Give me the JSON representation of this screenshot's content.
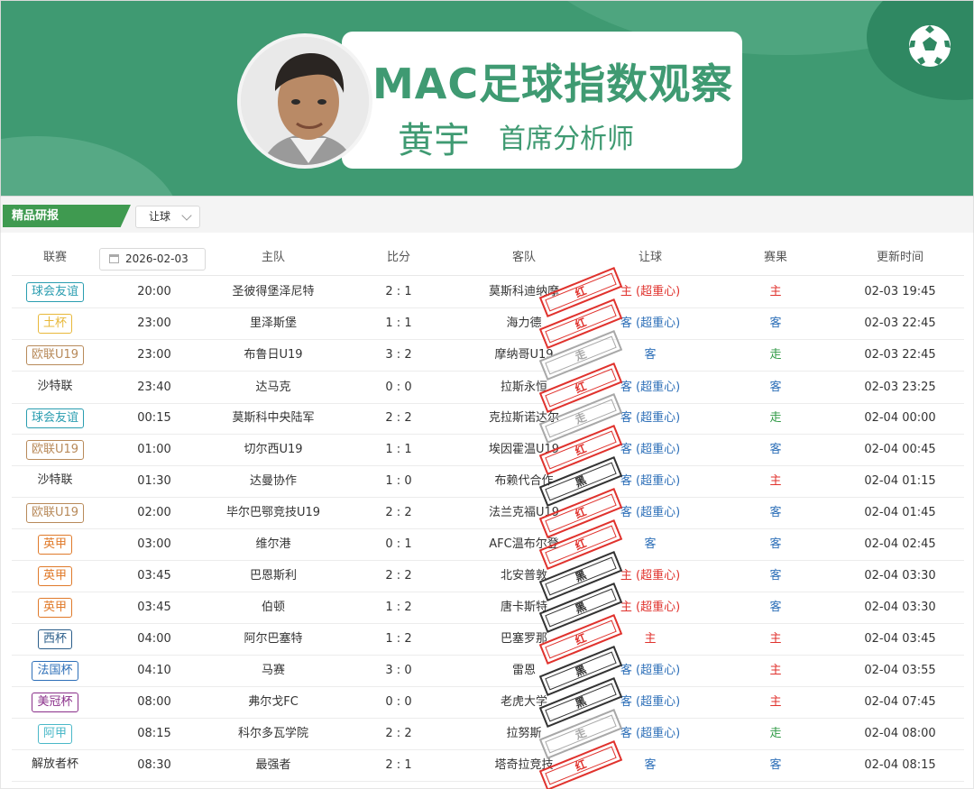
{
  "banner": {
    "title": "MAC足球指数观察",
    "analyst_name": "黄宇",
    "analyst_role": "首席分析师"
  },
  "subbar": {
    "section_label": "精品研报",
    "filter_value": "让球"
  },
  "table": {
    "headers": {
      "league": "联赛",
      "home": "主队",
      "score": "比分",
      "away": "客队",
      "handicap": "让球",
      "result": "赛果",
      "updated": "更新时间"
    },
    "date_value": "2026-02-03",
    "rows": [
      {
        "league": "球会友谊",
        "league_color": "#2a9db0",
        "time": "20:00",
        "home": "圣彼得堡泽尼特",
        "score": "2 : 1",
        "away": "莫斯科迪纳摩",
        "stamp": "红",
        "stamp_kind": "red",
        "handicap": "主 (超重心)",
        "handicap_kind": "red",
        "result": "主",
        "result_kind": "red",
        "updated": "02-03 19:45"
      },
      {
        "league": "土杯",
        "league_color": "#e8b83a",
        "time": "23:00",
        "home": "里泽斯堡",
        "score": "1 : 1",
        "away": "海力德",
        "stamp": "红",
        "stamp_kind": "red",
        "handicap": "客 (超重心)",
        "handicap_kind": "blue",
        "result": "客",
        "result_kind": "blue",
        "updated": "02-03 22:45"
      },
      {
        "league": "欧联U19",
        "league_color": "#b88a5a",
        "time": "23:00",
        "home": "布鲁日U19",
        "score": "3 : 2",
        "away": "摩纳哥U19",
        "stamp": "走",
        "stamp_kind": "gray",
        "handicap": "客",
        "handicap_kind": "blue",
        "result": "走",
        "result_kind": "green",
        "updated": "02-03 22:45"
      },
      {
        "league": "沙特联",
        "league_color": "",
        "time": "23:40",
        "home": "达马克",
        "score": "0 : 0",
        "away": "拉斯永恒",
        "stamp": "红",
        "stamp_kind": "red",
        "handicap": "客 (超重心)",
        "handicap_kind": "blue",
        "result": "客",
        "result_kind": "blue",
        "updated": "02-03 23:25"
      },
      {
        "league": "球会友谊",
        "league_color": "#2a9db0",
        "time": "00:15",
        "home": "莫斯科中央陆军",
        "score": "2 : 2",
        "away": "克拉斯诺达尔",
        "stamp": "走",
        "stamp_kind": "gray",
        "handicap": "客 (超重心)",
        "handicap_kind": "blue",
        "result": "走",
        "result_kind": "green",
        "updated": "02-04 00:00"
      },
      {
        "league": "欧联U19",
        "league_color": "#b88a5a",
        "time": "01:00",
        "home": "切尔西U19",
        "score": "1 : 1",
        "away": "埃因霍温U19",
        "stamp": "红",
        "stamp_kind": "red",
        "handicap": "客 (超重心)",
        "handicap_kind": "blue",
        "result": "客",
        "result_kind": "blue",
        "updated": "02-04 00:45"
      },
      {
        "league": "沙特联",
        "league_color": "",
        "time": "01:30",
        "home": "达曼协作",
        "score": "1 : 0",
        "away": "布赖代合作",
        "stamp": "黑",
        "stamp_kind": "black",
        "handicap": "客 (超重心)",
        "handicap_kind": "blue",
        "result": "主",
        "result_kind": "red",
        "updated": "02-04 01:15"
      },
      {
        "league": "欧联U19",
        "league_color": "#b88a5a",
        "time": "02:00",
        "home": "毕尔巴鄂竞技U19",
        "score": "2 : 2",
        "away": "法兰克福U19",
        "stamp": "红",
        "stamp_kind": "red",
        "handicap": "客 (超重心)",
        "handicap_kind": "blue",
        "result": "客",
        "result_kind": "blue",
        "updated": "02-04 01:45"
      },
      {
        "league": "英甲",
        "league_color": "#e07a2a",
        "time": "03:00",
        "home": "维尔港",
        "score": "0 : 1",
        "away": "AFC温布尔登",
        "stamp": "红",
        "stamp_kind": "red",
        "handicap": "客",
        "handicap_kind": "blue",
        "result": "客",
        "result_kind": "blue",
        "updated": "02-04 02:45"
      },
      {
        "league": "英甲",
        "league_color": "#e07a2a",
        "time": "03:45",
        "home": "巴恩斯利",
        "score": "2 : 2",
        "away": "北安普敦",
        "stamp": "黑",
        "stamp_kind": "black",
        "handicap": "主 (超重心)",
        "handicap_kind": "red",
        "result": "客",
        "result_kind": "blue",
        "updated": "02-04 03:30"
      },
      {
        "league": "英甲",
        "league_color": "#e07a2a",
        "time": "03:45",
        "home": "伯顿",
        "score": "1 : 2",
        "away": "唐卡斯特",
        "stamp": "黑",
        "stamp_kind": "black",
        "handicap": "主 (超重心)",
        "handicap_kind": "red",
        "result": "客",
        "result_kind": "blue",
        "updated": "02-04 03:30"
      },
      {
        "league": "西杯",
        "league_color": "#2b5e8a",
        "time": "04:00",
        "home": "阿尔巴塞特",
        "score": "1 : 2",
        "away": "巴塞罗那",
        "stamp": "红",
        "stamp_kind": "red",
        "handicap": "主",
        "handicap_kind": "red",
        "result": "主",
        "result_kind": "red",
        "updated": "02-04 03:45"
      },
      {
        "league": "法国杯",
        "league_color": "#2d6fb8",
        "time": "04:10",
        "home": "马赛",
        "score": "3 : 0",
        "away": "雷恩",
        "stamp": "黑",
        "stamp_kind": "black",
        "handicap": "客 (超重心)",
        "handicap_kind": "blue",
        "result": "主",
        "result_kind": "red",
        "updated": "02-04 03:55"
      },
      {
        "league": "美冠杯",
        "league_color": "#8a2f8a",
        "time": "08:00",
        "home": "弗尔戈FC",
        "score": "0 : 0",
        "away": "老虎大学",
        "stamp": "黑",
        "stamp_kind": "black",
        "handicap": "客 (超重心)",
        "handicap_kind": "blue",
        "result": "主",
        "result_kind": "red",
        "updated": "02-04 07:45"
      },
      {
        "league": "阿甲",
        "league_color": "#4ab8c8",
        "time": "08:15",
        "home": "科尔多瓦学院",
        "score": "2 : 2",
        "away": "拉努斯",
        "stamp": "走",
        "stamp_kind": "gray",
        "handicap": "客 (超重心)",
        "handicap_kind": "blue",
        "result": "走",
        "result_kind": "green",
        "updated": "02-04 08:00"
      },
      {
        "league": "解放者杯",
        "league_color": "",
        "time": "08:30",
        "home": "最强者",
        "score": "2 : 1",
        "away": "塔奇拉竞技",
        "stamp": "红",
        "stamp_kind": "red",
        "handicap": "客",
        "handicap_kind": "blue",
        "result": "客",
        "result_kind": "blue",
        "updated": "02-04 08:15"
      }
    ]
  },
  "colors": {
    "brand_green": "#3f9a72",
    "section_green": "#3f9a50",
    "home_red": "#e0322d",
    "away_blue": "#2d6fb8",
    "push_green": "#2f9a45",
    "stamp_gray": "#a8a8a8",
    "stamp_black": "#333333"
  },
  "icons": {
    "ball": "soccer-ball-icon",
    "calendar": "calendar-icon",
    "chevron": "chevron-down-icon"
  }
}
